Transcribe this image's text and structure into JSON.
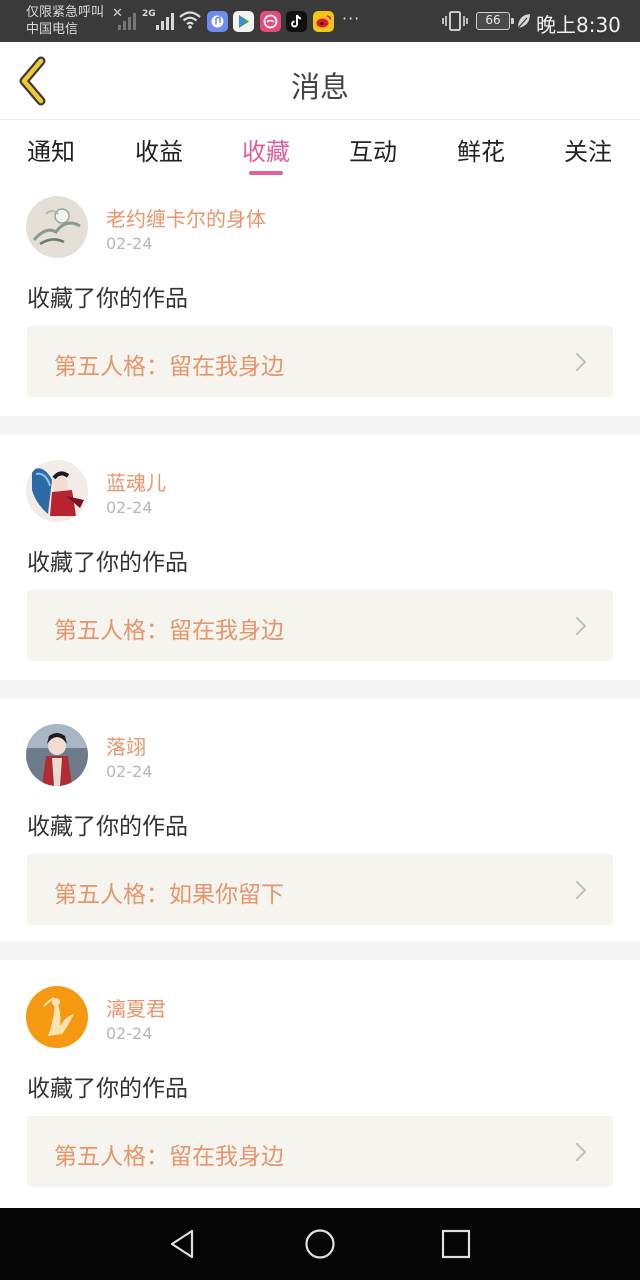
{
  "status_bar": {
    "carrier_line1": "仅限紧急呼叫",
    "carrier_line2": "中国电信",
    "network": "2G",
    "more": "···",
    "battery": "66",
    "time": "晚上8:30"
  },
  "header": {
    "title": "消息",
    "back_icon": "chevron-left-icon"
  },
  "tabs": [
    {
      "label": "通知",
      "active": false
    },
    {
      "label": "收益",
      "active": false
    },
    {
      "label": "收藏",
      "active": true
    },
    {
      "label": "互动",
      "active": false
    },
    {
      "label": "鲜花",
      "active": false
    },
    {
      "label": "关注",
      "active": false
    }
  ],
  "messages": [
    {
      "user": "老约缠卡尔的身体",
      "date": "02-24",
      "action": "收藏了你的作品",
      "work": "第五人格：留在我身边"
    },
    {
      "user": "蓝魂儿",
      "date": "02-24",
      "action": "收藏了你的作品",
      "work": "第五人格：留在我身边"
    },
    {
      "user": "落翊",
      "date": "02-24",
      "action": "收藏了你的作品",
      "work": "第五人格：如果你留下"
    },
    {
      "user": "漓夏君",
      "date": "02-24",
      "action": "收藏了你的作品",
      "work": "第五人格：留在我身边"
    }
  ],
  "colors": {
    "accent": "#e0609a",
    "name": "#e8956a",
    "back_icon": "#c9a227"
  }
}
